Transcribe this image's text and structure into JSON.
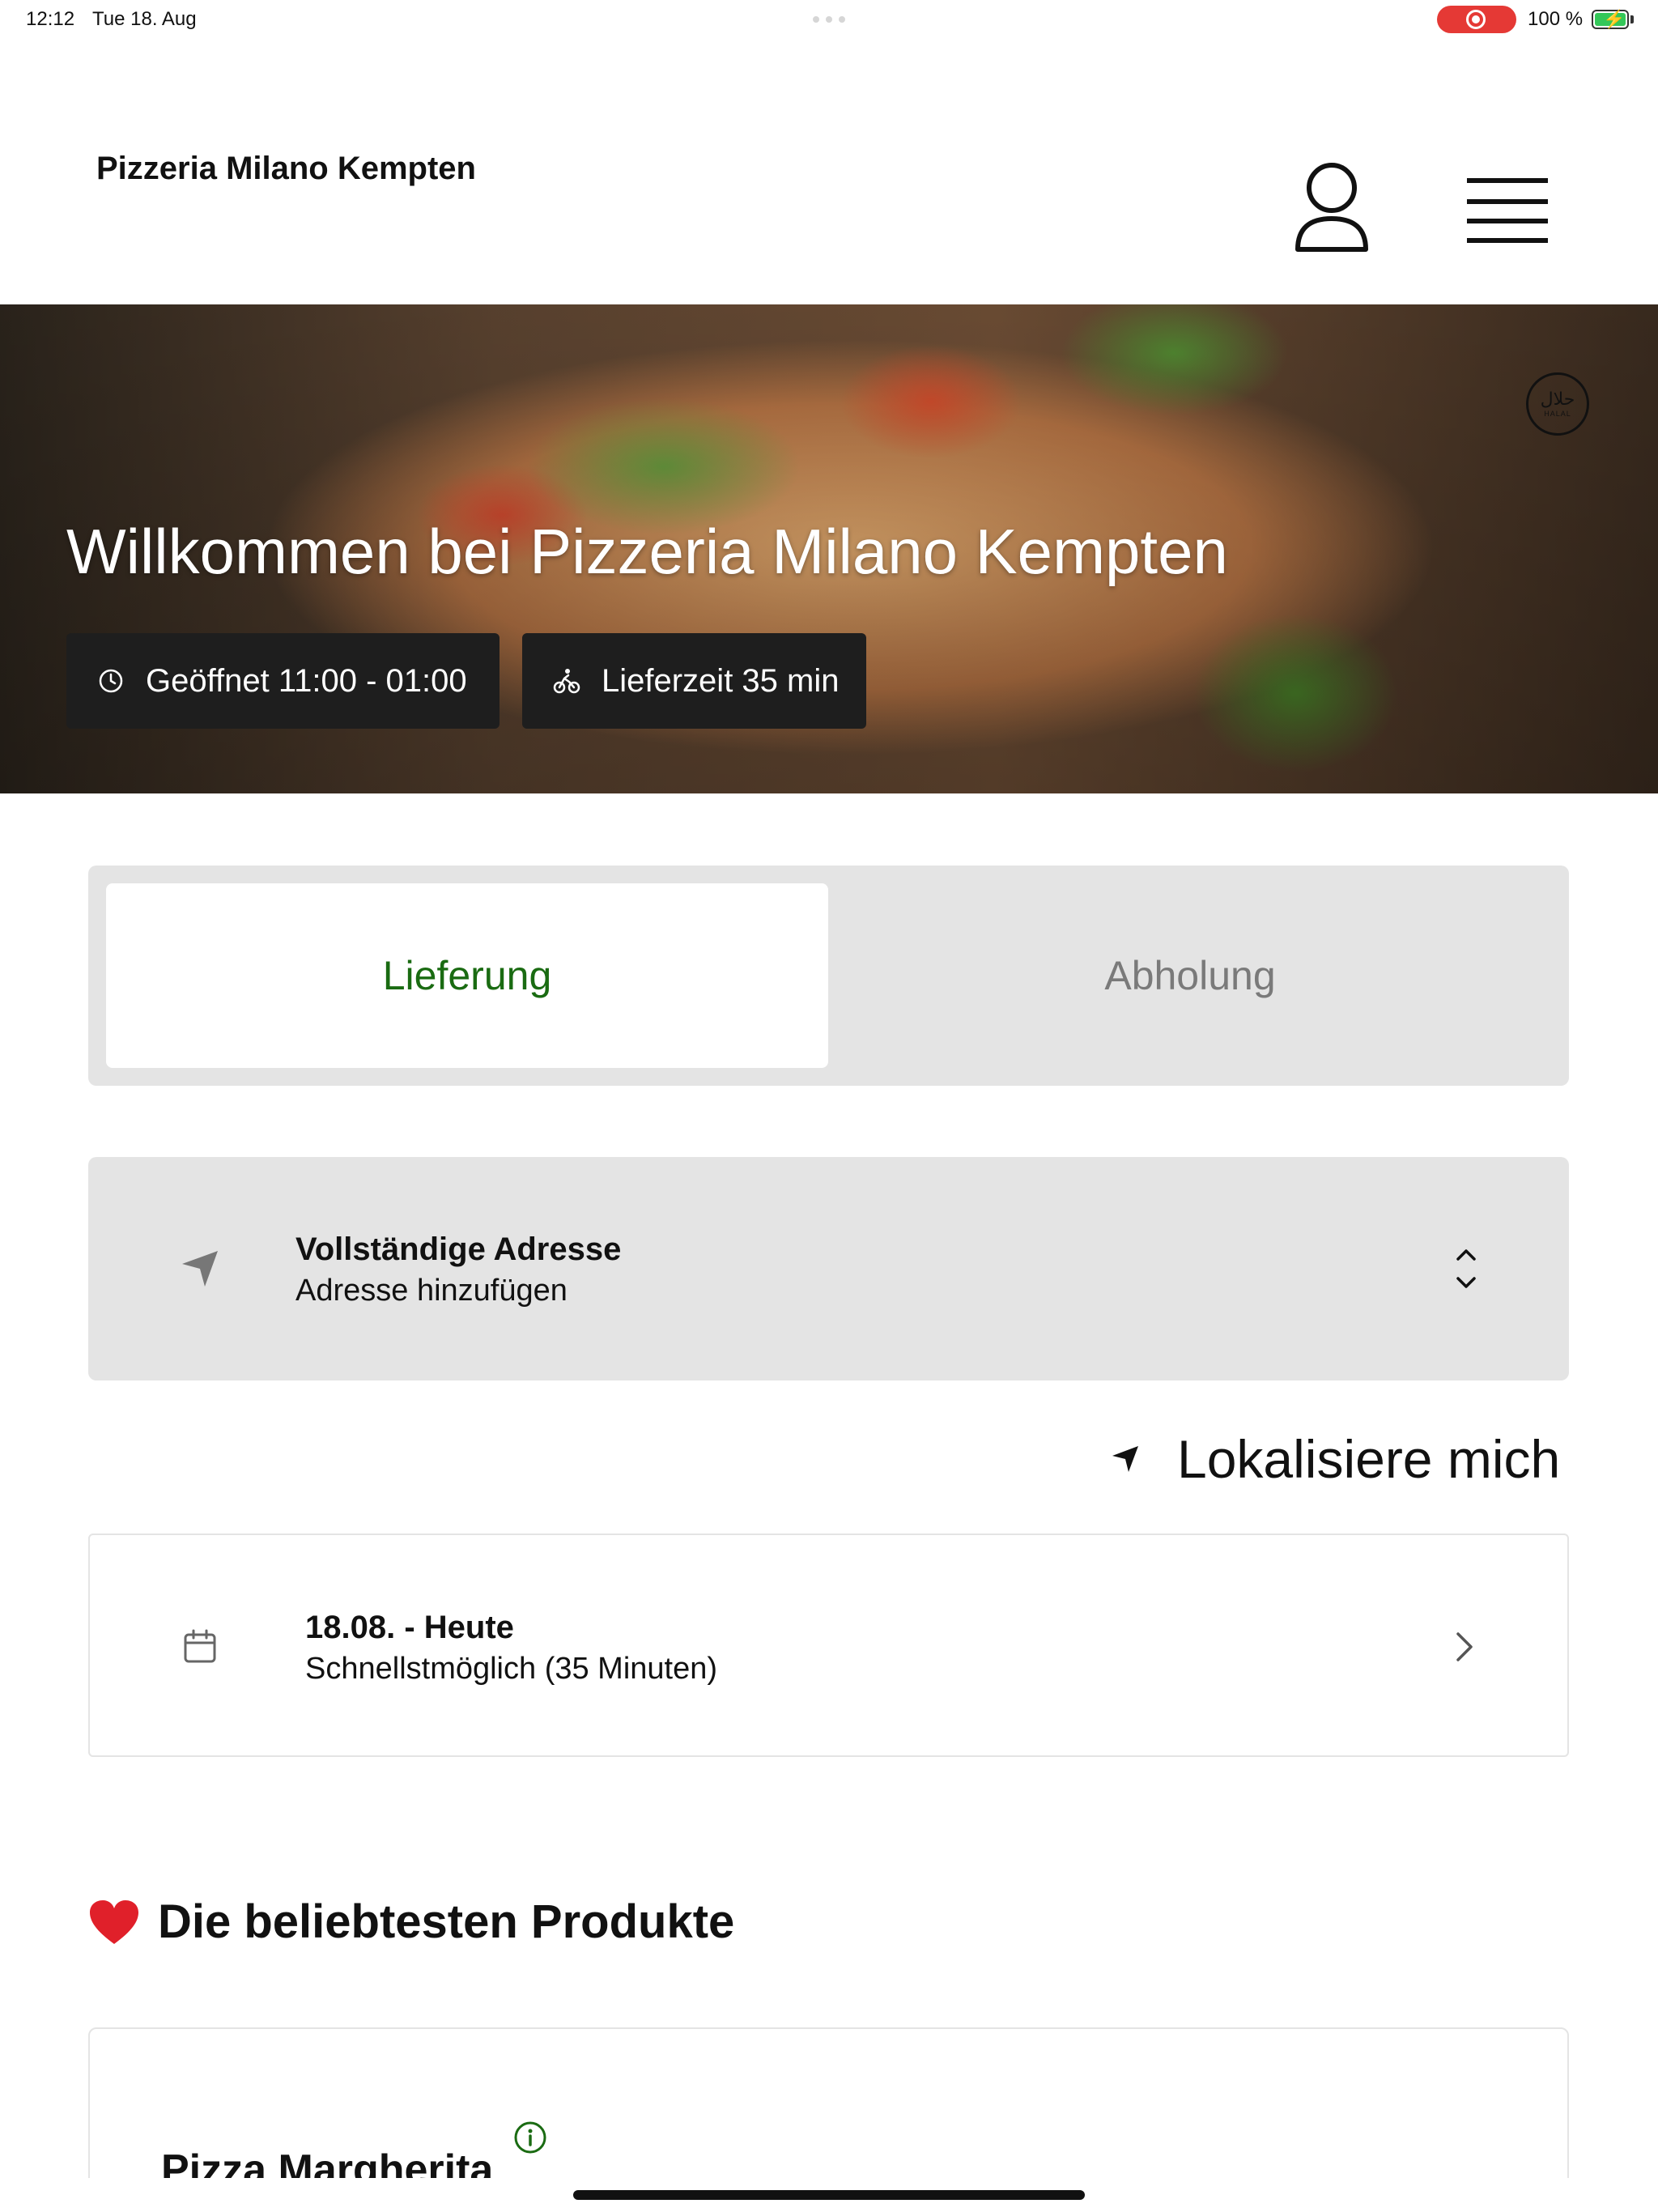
{
  "status_bar": {
    "time": "12:12",
    "date": "Tue 18. Aug",
    "battery": "100 %",
    "recording_color": "#e53935",
    "battery_fill_color": "#34c759"
  },
  "header": {
    "brand": "Pizzeria Milano Kempten",
    "user_icon": "user-icon",
    "menu_icon": "hamburger-menu-icon"
  },
  "hero": {
    "title": "Willkommen bei Pizzeria Milano Kempten",
    "badge_arabic": "حلال",
    "badge_text": "HALAL",
    "opening_hours": "Geöffnet 11:00 - 01:00",
    "delivery_time": "Lieferzeit 35 min",
    "open_icon": "clock-icon",
    "delivery_icon": "bike-icon"
  },
  "order_mode": {
    "options": [
      {
        "label": "Lieferung",
        "selected": true
      },
      {
        "label": "Abholung",
        "selected": false
      }
    ],
    "selected_color": "#1a6b12"
  },
  "address": {
    "title": "Vollständige Adresse",
    "value": "Adresse hinzufügen",
    "icon": "location-arrow-icon"
  },
  "locate": {
    "label": "Lokalisiere mich",
    "icon": "location-arrow-icon"
  },
  "schedule": {
    "title": "18.08. - Heute",
    "value": "Schnellstmöglich (35 Minuten)",
    "icon": "calendar-icon"
  },
  "products": {
    "section_title": "Die beliebtesten Produkte",
    "items": [
      {
        "name": "Pizza Margherita"
      }
    ]
  }
}
